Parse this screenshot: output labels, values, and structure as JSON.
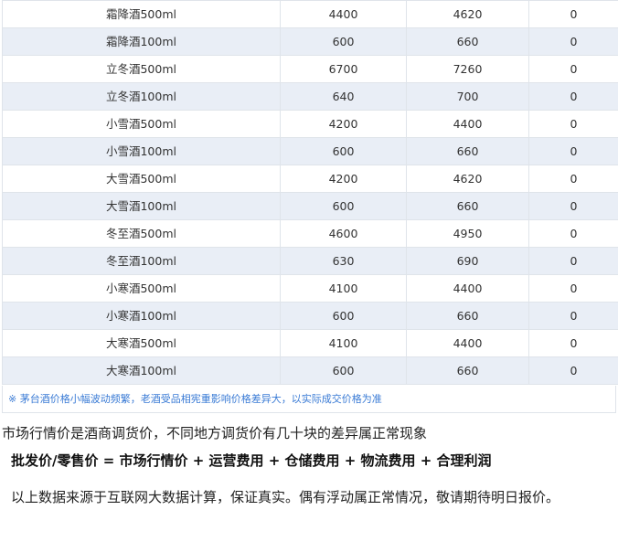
{
  "table": {
    "rows": [
      {
        "name": "霜降酒500ml",
        "price_a": "4400",
        "price_b": "4620",
        "change": "0"
      },
      {
        "name": "霜降酒100ml",
        "price_a": "600",
        "price_b": "660",
        "change": "0"
      },
      {
        "name": "立冬酒500ml",
        "price_a": "6700",
        "price_b": "7260",
        "change": "0"
      },
      {
        "name": "立冬酒100ml",
        "price_a": "640",
        "price_b": "700",
        "change": "0"
      },
      {
        "name": "小雪酒500ml",
        "price_a": "4200",
        "price_b": "4400",
        "change": "0"
      },
      {
        "name": "小雪酒100ml",
        "price_a": "600",
        "price_b": "660",
        "change": "0"
      },
      {
        "name": "大雪酒500ml",
        "price_a": "4200",
        "price_b": "4620",
        "change": "0"
      },
      {
        "name": "大雪酒100ml",
        "price_a": "600",
        "price_b": "660",
        "change": "0"
      },
      {
        "name": "冬至酒500ml",
        "price_a": "4600",
        "price_b": "4950",
        "change": "0"
      },
      {
        "name": "冬至酒100ml",
        "price_a": "630",
        "price_b": "690",
        "change": "0"
      },
      {
        "name": "小寒酒500ml",
        "price_a": "4100",
        "price_b": "4400",
        "change": "0"
      },
      {
        "name": "小寒酒100ml",
        "price_a": "600",
        "price_b": "660",
        "change": "0"
      },
      {
        "name": "大寒酒500ml",
        "price_a": "4100",
        "price_b": "4400",
        "change": "0"
      },
      {
        "name": "大寒酒100ml",
        "price_a": "600",
        "price_b": "660",
        "change": "0"
      }
    ],
    "note": "※ 茅台酒价格小幅波动频繁，老酒受品相宪重影响价格差异大，以实际成交价格为准"
  },
  "paragraphs": {
    "market": "市场行情价是酒商调货价，不同地方调货价有几十块的差异属正常现象",
    "formula": "批发价/零售价 = 市场行情价 + 运营费用 + 仓储费用 + 物流费用 + 合理利润",
    "source": "以上数据来源于互联网大数据计算，保证真实。偶有浮动属正常情况，敬请期待明日报价。"
  },
  "colors": {
    "alt_row": "#e9eef6",
    "note_text": "#3a7bd5",
    "border": "#dfe4ea"
  }
}
